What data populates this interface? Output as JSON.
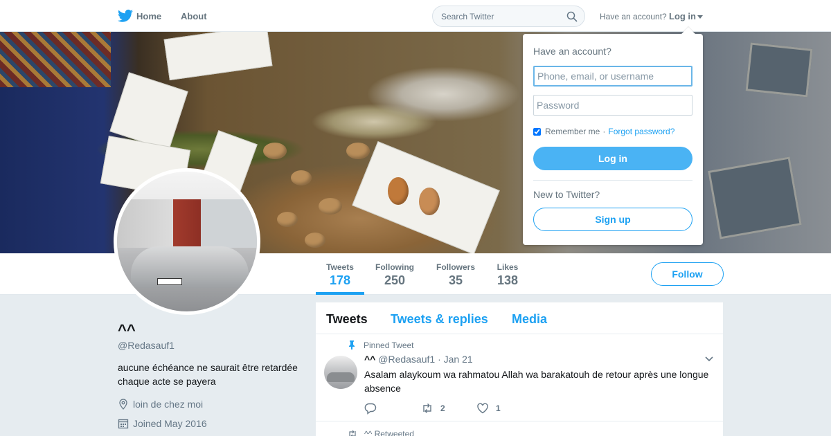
{
  "nav": {
    "home_label": "Home",
    "about_label": "About",
    "search_placeholder": "Search Twitter",
    "have_account_text": "Have an account?",
    "login_label": "Log in"
  },
  "profile": {
    "name": "^^",
    "handle": "@Redasauf1",
    "bio_line1": "aucune échéance ne saurait être retardée",
    "bio_line2": "chaque acte se payera",
    "location": "loin de chez moi",
    "joined": "Joined May 2016",
    "follow_label": "Follow"
  },
  "stats": [
    {
      "label": "Tweets",
      "value": "178",
      "active": true
    },
    {
      "label": "Following",
      "value": "250",
      "active": false
    },
    {
      "label": "Followers",
      "value": "35",
      "active": false
    },
    {
      "label": "Likes",
      "value": "138",
      "active": false
    }
  ],
  "timeline": {
    "tabs": [
      "Tweets",
      "Tweets & replies",
      "Media"
    ],
    "pinned_tweet": {
      "pinned_label": "Pinned Tweet",
      "name": "^^",
      "handle": "@Redasauf1",
      "separator": "·",
      "date": "Jan 21",
      "text": "Asalam alaykoum wa rahmatou Allah wa barakatouh de retour après une longue absence",
      "reply_count": "",
      "retweet_count": "2",
      "like_count": "1"
    },
    "next_row_label": "^^ Retweeted"
  },
  "login_dropdown": {
    "title": "Have an account?",
    "username_placeholder": "Phone, email, or username",
    "password_placeholder": "Password",
    "remember_label": "Remember me",
    "separator": "·",
    "forgot_label": "Forgot password?",
    "login_button": "Log in",
    "new_label": "New to Twitter?",
    "signup_button": "Sign up"
  },
  "colors": {
    "accent": "#1da1f2",
    "login_button": "#4ab3f4",
    "background": "#e6ecf0"
  },
  "icons": [
    "twitter-bird-icon",
    "search-icon",
    "caret-down-icon",
    "location-icon",
    "calendar-icon",
    "pin-icon",
    "chevron-down-icon",
    "reply-icon",
    "retweet-icon",
    "heart-icon"
  ]
}
